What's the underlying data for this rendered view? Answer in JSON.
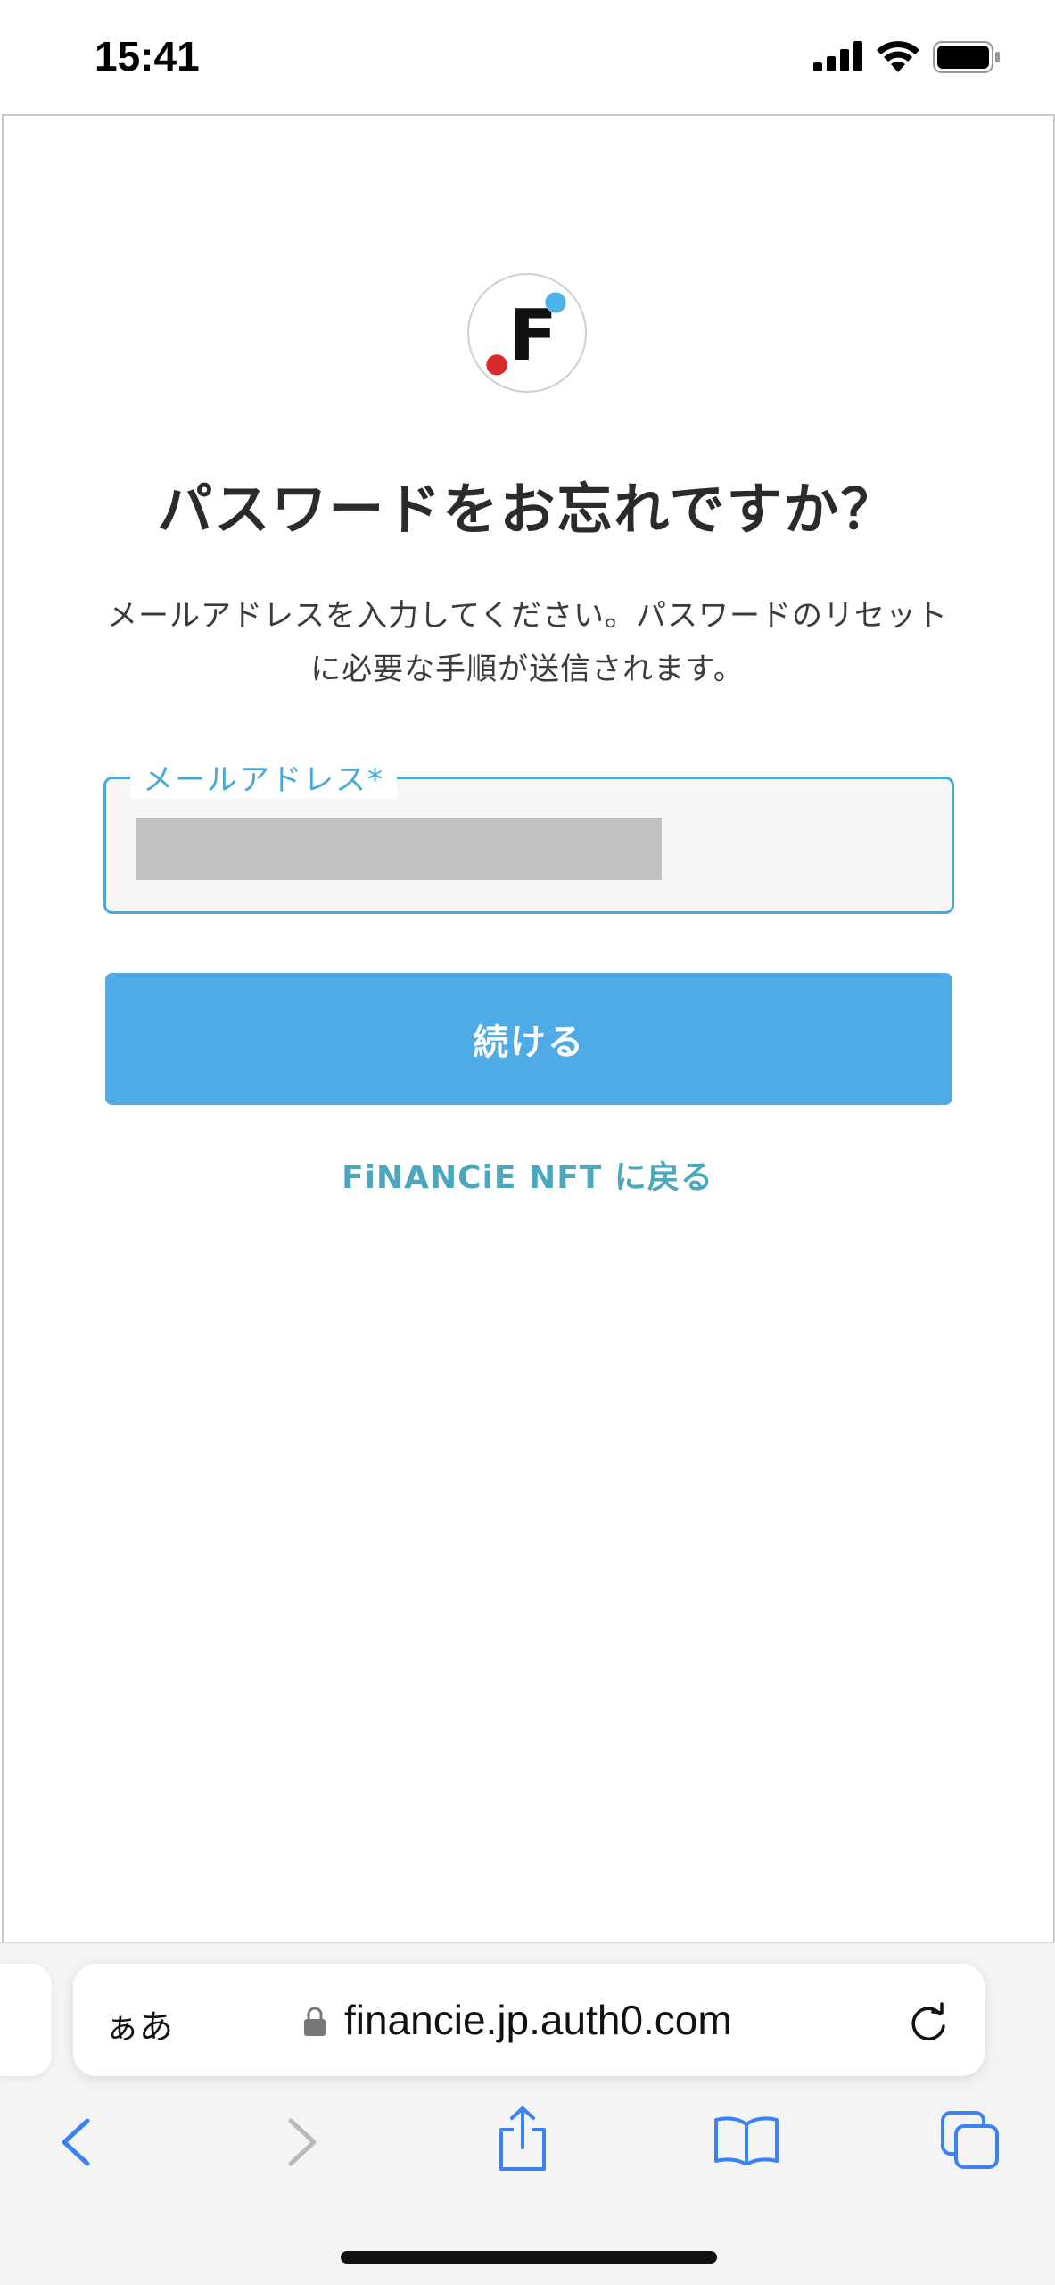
{
  "status_bar": {
    "time": "15:41"
  },
  "page": {
    "title": "パスワードをお忘れですか？",
    "description": "メールアドレスを入力してください。パスワードのリセットに必要な手順が送信されます。",
    "email_label": "メールアドレス*",
    "continue_label": "続ける",
    "back_link": "FiNANCiE NFT に戻る"
  },
  "browser": {
    "text_size_label": "ぁあ",
    "url": "financie.jp.auth0.com"
  },
  "colors": {
    "accent": "#4eabe6",
    "field_border": "#48a9d7",
    "link": "#4aa7bd",
    "logo_blue_dot": "#4db3e8",
    "logo_red_dot": "#d92b2b",
    "browser_icon": "#3b82f6"
  },
  "icons": {
    "status": [
      "signal-icon",
      "wifi-icon",
      "battery-icon"
    ],
    "browser": [
      "lock-icon",
      "reload-icon",
      "back-icon",
      "forward-icon",
      "share-icon",
      "bookmarks-icon",
      "tabs-icon"
    ]
  }
}
